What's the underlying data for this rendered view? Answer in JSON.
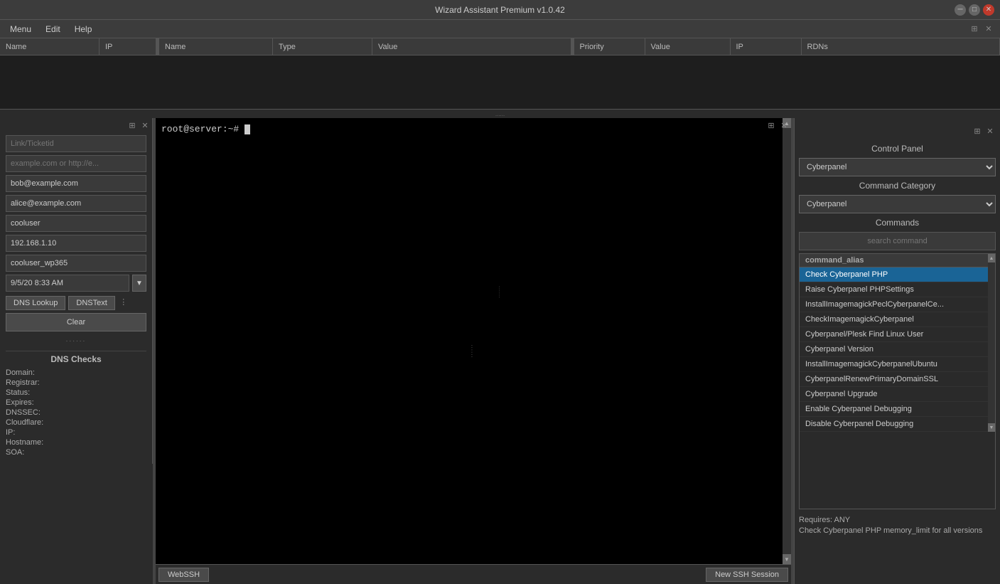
{
  "titleBar": {
    "title": "Wizard Assistant Premium v1.0.42"
  },
  "menuBar": {
    "items": [
      "Menu",
      "Edit",
      "Help"
    ]
  },
  "topTable": {
    "columns1": [
      "Name",
      "IP"
    ],
    "columns2": [
      "Name",
      "Type",
      "Value"
    ],
    "columns3": [
      "Priority",
      "Value",
      "IP",
      "RDNs"
    ]
  },
  "leftPanel": {
    "fields": {
      "linkTicketid": "Link/Ticketid",
      "domain": "example.com or http://e...",
      "email1": "bob@example.com",
      "email2": "alice@example.com",
      "username": "cooluser",
      "ip": "192.168.1.10",
      "username2": "cooluser_wp365",
      "datetime": "9/5/20 8:33 AM"
    },
    "buttons": {
      "dnsLookup": "DNS Lookup",
      "dnsText": "DNSText",
      "clear": "Clear"
    },
    "dnsChecks": {
      "title": "DNS Checks",
      "domain_label": "Domain:",
      "registrar_label": "Registrar:",
      "status_label": "Status:",
      "expires_label": "Expires:",
      "dnssec_label": "DNSSEC:",
      "cloudflare_label": "Cloudflare:",
      "ip_label": "IP:",
      "hostname_label": "Hostname:",
      "soa_label": "SOA:",
      "domain_value": "",
      "registrar_value": "",
      "status_value": "",
      "expires_value": "",
      "dnssec_value": "",
      "cloudflare_value": "",
      "ip_value": "",
      "hostname_value": "",
      "soa_value": ""
    }
  },
  "ssh": {
    "prompt": "root@server:~# ",
    "buttons": {
      "webssh": "WebSSH",
      "newSession": "New SSH Session"
    }
  },
  "rightPanel": {
    "controlPanelLabel": "Control Panel",
    "controlPanelSelected": "Cyberpanel",
    "commandCategoryLabel": "Command Category",
    "commandCategorySelected": "Cyberpanel",
    "commandsLabel": "Commands",
    "searchPlaceholder": "search command",
    "commandColumnHeader": "command_alias",
    "commands": [
      {
        "name": "Check Cyberpanel PHP",
        "selected": true
      },
      {
        "name": "Raise Cyberpanel PHPSettings",
        "selected": false
      },
      {
        "name": "InstallImagemagickPeclCyberpanelCe...",
        "selected": false
      },
      {
        "name": "CheckImagemagickCyberpanel",
        "selected": false
      },
      {
        "name": "Cyberpanel/Plesk Find Linux User",
        "selected": false
      },
      {
        "name": "Cyberpanel Version",
        "selected": false
      },
      {
        "name": "InstallImagemagickCyberpanelUbuntu",
        "selected": false
      },
      {
        "name": "CyberpanelRenewPrimaryDomainSSL",
        "selected": false
      },
      {
        "name": "Cyberpanel Upgrade",
        "selected": false
      },
      {
        "name": "Enable Cyberpanel Debugging",
        "selected": false
      },
      {
        "name": "Disable Cyberpanel Debugging",
        "selected": false
      }
    ],
    "requiresLabel": "Requires: ANY",
    "requiresDescription": "Check Cyberpanel PHP memory_limit for all versions"
  }
}
